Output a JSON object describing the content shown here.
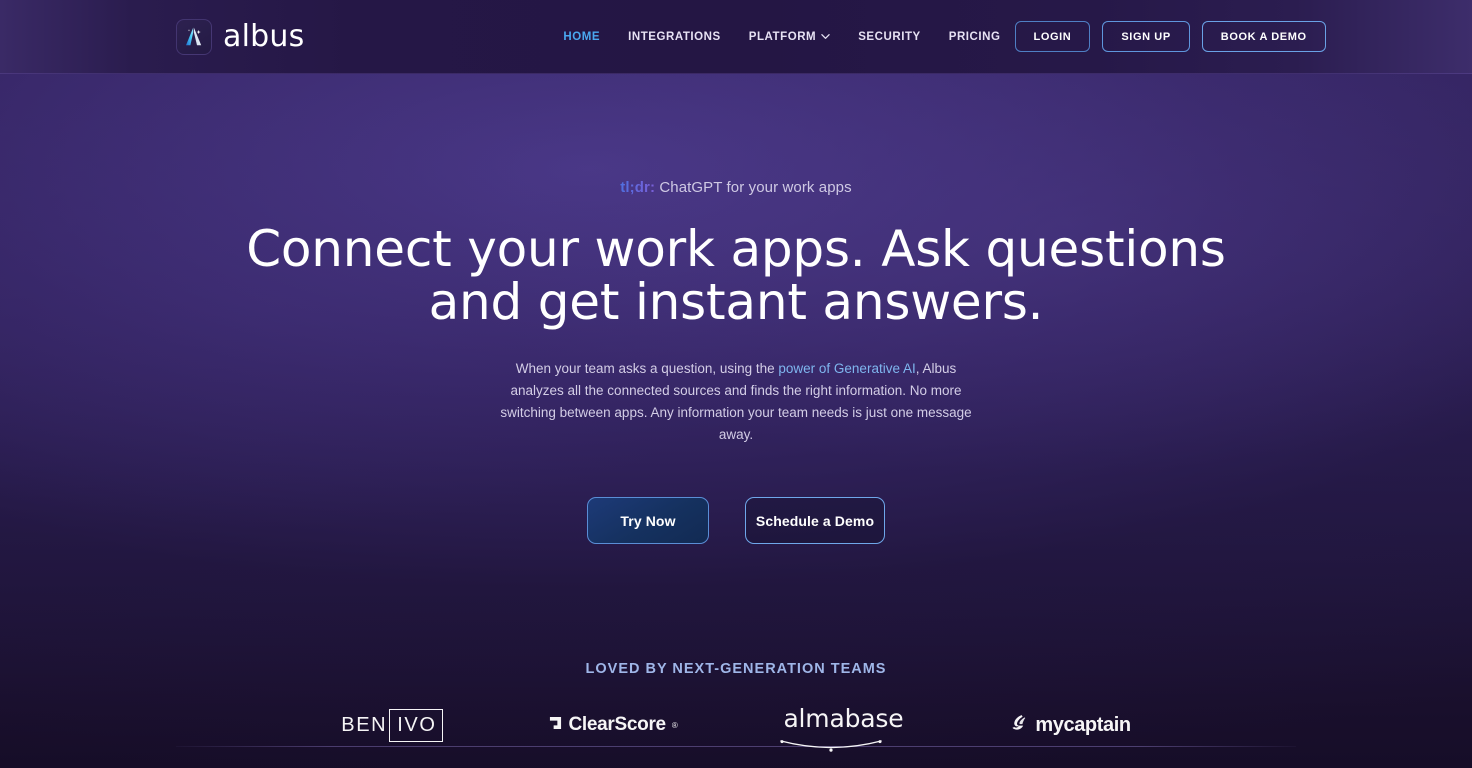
{
  "brand": {
    "name": "albus",
    "logo_icon": "wand-chevron-icon"
  },
  "nav": {
    "items": [
      {
        "label": "HOME",
        "active": true,
        "has_chevron": false
      },
      {
        "label": "INTEGRATIONS",
        "active": false,
        "has_chevron": false
      },
      {
        "label": "PLATFORM",
        "active": false,
        "has_chevron": true
      },
      {
        "label": "SECURITY",
        "active": false,
        "has_chevron": false
      },
      {
        "label": "PRICING",
        "active": false,
        "has_chevron": false
      }
    ]
  },
  "header_actions": {
    "login": "LOGIN",
    "signup": "SIGN UP",
    "demo": "BOOK A DEMO"
  },
  "hero": {
    "tldr_label": "tl;dr:",
    "tldr_text": " ChatGPT for your work apps",
    "headline_line1": "Connect your work apps. Ask questions",
    "headline_line2": "and get instant answers.",
    "subcopy_before": "When your team asks a question, using the ",
    "subcopy_link": "power of Generative AI",
    "subcopy_after": ", Albus analyzes all the connected sources and finds the right information. No more switching between apps. Any information your team needs is just one message away.",
    "cta_primary": "Try Now",
    "cta_secondary": "Schedule a Demo"
  },
  "proof": {
    "title": "LOVED BY NEXT-GENERATION TEAMS",
    "logos": [
      {
        "name": "BENIVO",
        "part_a": "BEN",
        "part_b": "IVO"
      },
      {
        "name": "ClearScore",
        "text": "ClearScore",
        "icon": "clearscore-square-icon",
        "registered": "®"
      },
      {
        "name": "almabase",
        "text": "almabase",
        "icon": "almabase-arc-icon"
      },
      {
        "name": "mycaptain",
        "text": "mycaptain",
        "icon": "mycaptain-swoosh-icon"
      }
    ]
  },
  "colors": {
    "accent_blue": "#4aa8f0",
    "link_blue": "#7fb6ef",
    "button_border": "#5b8fd8",
    "proof_title": "#9fb6e8",
    "bg_top": "#3a2a6e",
    "bg_bottom": "#160d28"
  }
}
